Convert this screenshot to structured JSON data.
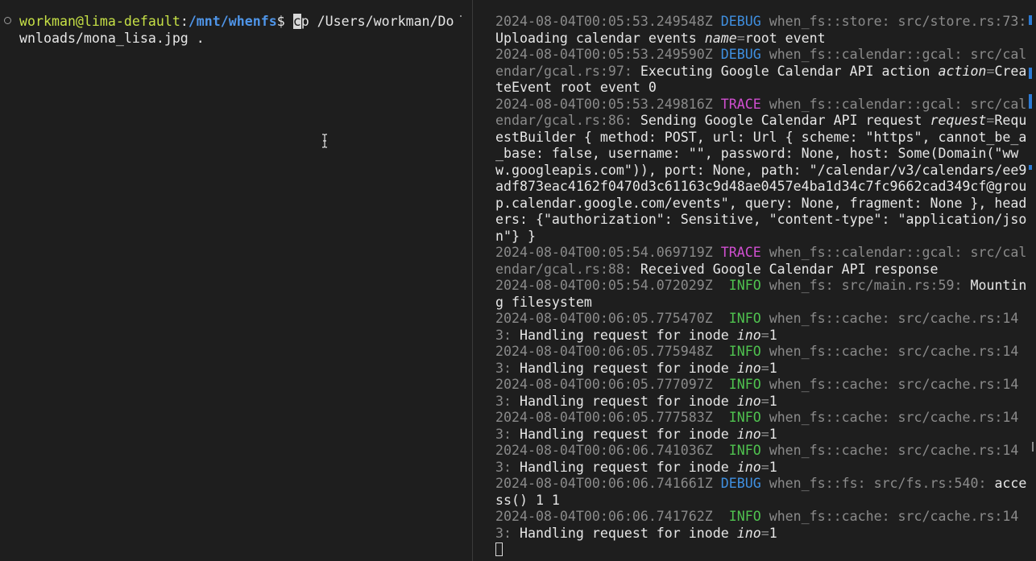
{
  "left_terminal": {
    "prompt_user": "workman@lima-default",
    "prompt_sep": ":",
    "prompt_path": "/mnt/whenfs",
    "prompt_symbol": "$ ",
    "cmd_first_char": "c",
    "cmd_rest": "p /Users/workman/Downloads/mona_lisa.jpg ."
  },
  "right_terminal": {
    "logs": [
      {
        "ts": "2024-08-04T00:05:53.249548Z",
        "level": "DEBUG",
        "level_class": "lvl-debug",
        "target": "when_fs::store: src/store.rs:73:",
        "msg": " Uploading calendar events ",
        "kv": [
          {
            "k": "name",
            "v": "root event"
          }
        ],
        "tail": ""
      },
      {
        "ts": "2024-08-04T00:05:53.249590Z",
        "level": "DEBUG",
        "level_class": "lvl-debug",
        "target": "when_fs::calendar::gcal: src/calendar/gcal.rs:97:",
        "msg": " Executing Google Calendar API action ",
        "kv": [
          {
            "k": "action",
            "v": "CreateEvent root event 0"
          }
        ],
        "tail": ""
      },
      {
        "ts": "2024-08-04T00:05:53.249816Z",
        "level": "TRACE",
        "level_class": "lvl-trace",
        "target": "when_fs::calendar::gcal: src/calendar/gcal.rs:86:",
        "msg": " Sending Google Calendar API request ",
        "kv": [
          {
            "k": "request",
            "v": "RequestBuilder { method: POST, url: Url { scheme: \"https\", cannot_be_a_base: false, username: \"\", password: None, host: Some(Domain(\"www.googleapis.com\")), port: None, path: \"/calendar/v3/calendars/ee9adf873eac4162f0470d3c61163c9d48ae0457e4ba1d34c7fc9662cad349cf@group.calendar.google.com/events\", query: None, fragment: None }, headers: {\"authorization\": Sensitive, \"content-type\": \"application/json\"} }"
          }
        ],
        "tail": ""
      },
      {
        "ts": "2024-08-04T00:05:54.069719Z",
        "level": "TRACE",
        "level_class": "lvl-trace",
        "target": "when_fs::calendar::gcal: src/calendar/gcal.rs:88:",
        "msg": " Received Google Calendar API response",
        "kv": [],
        "tail": ""
      },
      {
        "ts": "2024-08-04T00:05:54.072029Z",
        "level": " INFO",
        "level_class": "lvl-info",
        "target": "when_fs: src/main.rs:59:",
        "msg": " Mounting filesystem",
        "kv": [],
        "tail": ""
      },
      {
        "ts": "2024-08-04T00:06:05.775470Z",
        "level": " INFO",
        "level_class": "lvl-info",
        "target": "when_fs::cache: src/cache.rs:143:",
        "msg": " Handling request for inode ",
        "kv": [
          {
            "k": "ino",
            "v": "1"
          }
        ],
        "tail": ""
      },
      {
        "ts": "2024-08-04T00:06:05.775948Z",
        "level": " INFO",
        "level_class": "lvl-info",
        "target": "when_fs::cache: src/cache.rs:143:",
        "msg": " Handling request for inode ",
        "kv": [
          {
            "k": "ino",
            "v": "1"
          }
        ],
        "tail": ""
      },
      {
        "ts": "2024-08-04T00:06:05.777097Z",
        "level": " INFO",
        "level_class": "lvl-info",
        "target": "when_fs::cache: src/cache.rs:143:",
        "msg": " Handling request for inode ",
        "kv": [
          {
            "k": "ino",
            "v": "1"
          }
        ],
        "tail": ""
      },
      {
        "ts": "2024-08-04T00:06:05.777583Z",
        "level": " INFO",
        "level_class": "lvl-info",
        "target": "when_fs::cache: src/cache.rs:143:",
        "msg": " Handling request for inode ",
        "kv": [
          {
            "k": "ino",
            "v": "1"
          }
        ],
        "tail": ""
      },
      {
        "ts": "2024-08-04T00:06:06.741036Z",
        "level": " INFO",
        "level_class": "lvl-info",
        "target": "when_fs::cache: src/cache.rs:143:",
        "msg": " Handling request for inode ",
        "kv": [
          {
            "k": "ino",
            "v": "1"
          }
        ],
        "tail": ""
      },
      {
        "ts": "2024-08-04T00:06:06.741661Z",
        "level": "DEBUG",
        "level_class": "lvl-debug",
        "target": "when_fs::fs: src/fs.rs:540:",
        "msg": " access() 1 1",
        "kv": [],
        "tail": ""
      },
      {
        "ts": "2024-08-04T00:06:06.741762Z",
        "level": " INFO",
        "level_class": "lvl-info",
        "target": "when_fs::cache: src/cache.rs:143:",
        "msg": " Handling request for inode ",
        "kv": [
          {
            "k": "ino",
            "v": "1"
          }
        ],
        "tail": ""
      }
    ]
  },
  "colors": {
    "background": "#1e1e1e",
    "prompt_user": "#c6e046",
    "prompt_path": "#4f95e8",
    "debug": "#3f8fe0",
    "trace": "#d04fd0",
    "info": "#4fc24f",
    "muted": "#8a8a8a"
  },
  "icons": {
    "prompt_marker": "circle-icon",
    "mouse_pointer": "text-cursor-icon"
  }
}
